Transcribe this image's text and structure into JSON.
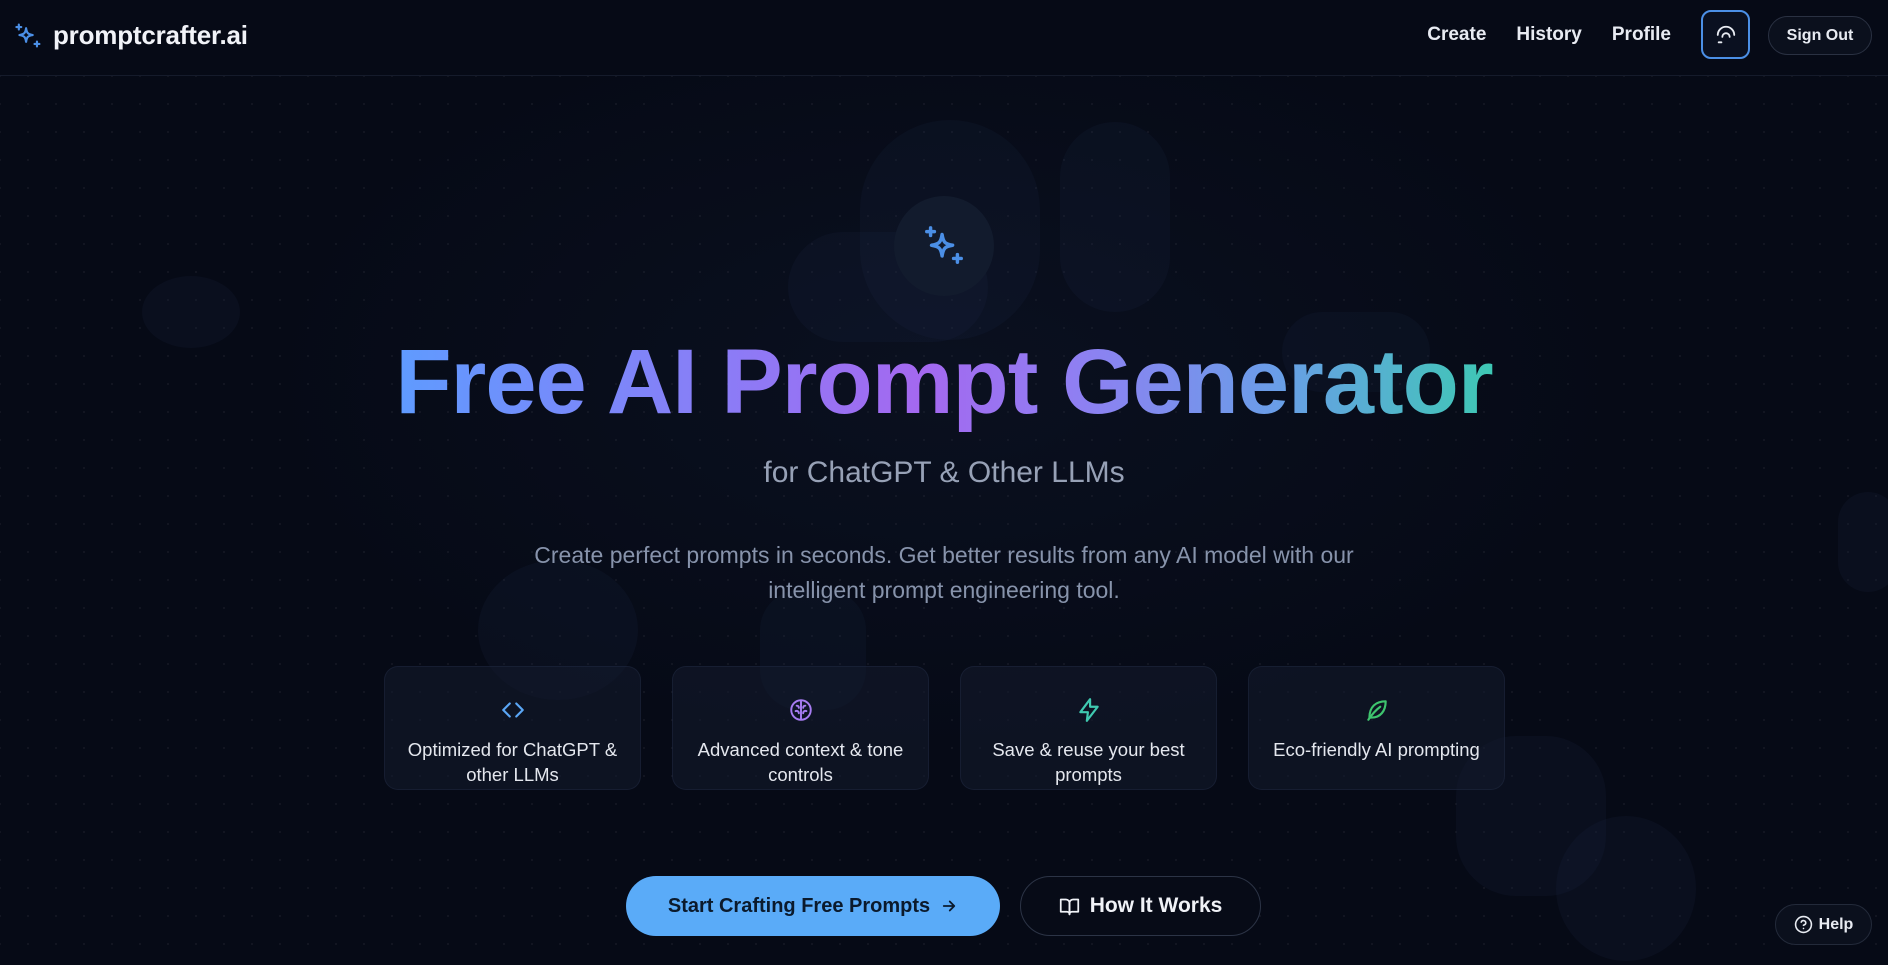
{
  "brand": {
    "name": "promptcrafter.ai",
    "icon": "sparkles-icon",
    "accent": "#4b8fe6"
  },
  "nav": {
    "links": [
      "Create",
      "History",
      "Profile"
    ],
    "theme_icon": "palette-icon",
    "sign_out": "Sign Out"
  },
  "hero": {
    "icon": "sparkles-icon",
    "title": "Free AI Prompt Generator",
    "subtitle": "for ChatGPT & Other LLMs",
    "description": "Create perfect prompts in seconds. Get better results from any AI model with our intelligent prompt engineering tool."
  },
  "features": [
    {
      "icon": "code-icon",
      "color": "#5aa6f5",
      "text": "Optimized for ChatGPT & other LLMs"
    },
    {
      "icon": "brain-icon",
      "color": "#a77cf2",
      "text": "Advanced context & tone controls"
    },
    {
      "icon": "lightning-icon",
      "color": "#3fc9b0",
      "text": "Save & reuse your best prompts"
    },
    {
      "icon": "leaf-icon",
      "color": "#3ec46e",
      "text": "Eco-friendly AI prompting"
    }
  ],
  "cta": {
    "primary": "Start Crafting Free Prompts",
    "secondary": "How It Works",
    "primary_color": "#5aabf8"
  },
  "help": {
    "label": "Help",
    "icon": "question-circle-icon"
  }
}
